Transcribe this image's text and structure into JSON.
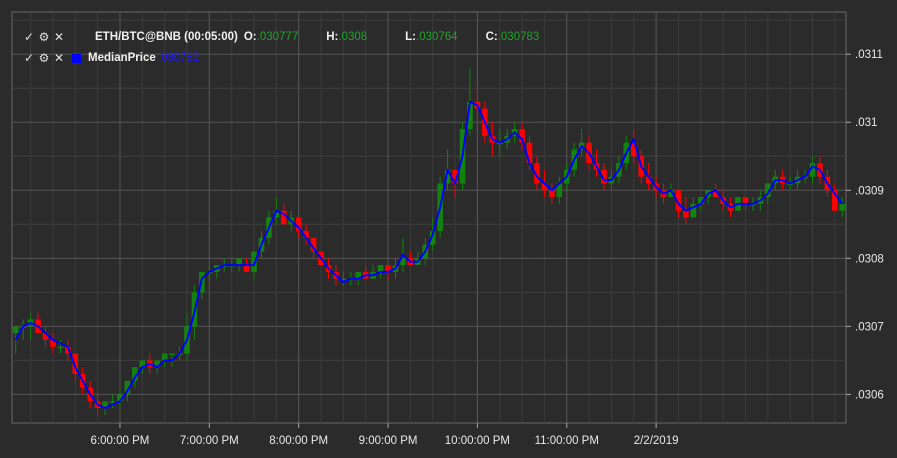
{
  "legend": {
    "series1": {
      "title": "ETH/BTC@BNB (00:05:00)",
      "o_label": "O:",
      "o_value": ".030777",
      "h_label": "H:",
      "h_value": ".0308",
      "l_label": "L:",
      "l_value": ".030764",
      "c_label": "C:",
      "c_value": ".030783"
    },
    "series2": {
      "title": "MedianPrice",
      "value": ".030782"
    }
  },
  "icons": {
    "check": "check-icon",
    "settings": "gear-icon",
    "close": "close-icon"
  },
  "colors": {
    "background": "#2b2b2b",
    "grid_major": "#555555",
    "grid_minor": "#3c3c3c",
    "up": "#14820f",
    "down": "#ff0000",
    "median_line": "#0000ff",
    "text": "#e8e8e8",
    "legend_value": "#1fa32a"
  },
  "chart_data": {
    "type": "candlestick",
    "y_ticks": [
      ".0306",
      ".0307",
      ".0308",
      ".0309",
      ".031",
      ".0311"
    ],
    "y_tick_values": [
      0.0306,
      0.0307,
      0.0308,
      0.0309,
      0.031,
      0.0311
    ],
    "ylim": [
      0.030558,
      0.031162
    ],
    "x_ticks": [
      "6:00:00 PM",
      "7:00:00 PM",
      "8:00:00 PM",
      "9:00:00 PM",
      "10:00:00 PM",
      "11:00:00 PM",
      "2/2/2019"
    ],
    "x_tick_candle_index": [
      14,
      26,
      38,
      50,
      62,
      74,
      86
    ],
    "grid": true,
    "candles": [
      [
        0.03069,
        0.0307,
        0.03066,
        0.0307
      ],
      [
        0.0307,
        0.03071,
        0.03068,
        0.0307
      ],
      [
        0.0307,
        0.03072,
        0.03068,
        0.03071
      ],
      [
        0.03071,
        0.03072,
        0.03069,
        0.03069
      ],
      [
        0.03069,
        0.0307,
        0.03067,
        0.03068
      ],
      [
        0.03068,
        0.03069,
        0.03066,
        0.03067
      ],
      [
        0.03067,
        0.03068,
        0.03066,
        0.03067
      ],
      [
        0.03067,
        0.03068,
        0.03065,
        0.03066
      ],
      [
        0.03066,
        0.03066,
        0.03062,
        0.03063
      ],
      [
        0.03063,
        0.03064,
        0.0306,
        0.03061
      ],
      [
        0.03061,
        0.03062,
        0.03058,
        0.03059
      ],
      [
        0.03059,
        0.0306,
        0.03057,
        0.03058
      ],
      [
        0.03058,
        0.03059,
        0.03057,
        0.03059
      ],
      [
        0.03059,
        0.0306,
        0.03058,
        0.03059
      ],
      [
        0.03059,
        0.03061,
        0.03058,
        0.0306
      ],
      [
        0.0306,
        0.03062,
        0.03059,
        0.03062
      ],
      [
        0.03062,
        0.03064,
        0.03061,
        0.03064
      ],
      [
        0.03064,
        0.03065,
        0.03063,
        0.03065
      ],
      [
        0.03065,
        0.03066,
        0.03063,
        0.03064
      ],
      [
        0.03064,
        0.03065,
        0.03063,
        0.03065
      ],
      [
        0.03065,
        0.03066,
        0.03064,
        0.03066
      ],
      [
        0.03066,
        0.03066,
        0.03064,
        0.03066
      ],
      [
        0.03066,
        0.03067,
        0.03065,
        0.03066
      ],
      [
        0.03066,
        0.03072,
        0.03065,
        0.0307
      ],
      [
        0.0307,
        0.03076,
        0.03068,
        0.03075
      ],
      [
        0.03075,
        0.03078,
        0.03074,
        0.03078
      ],
      [
        0.03078,
        0.03079,
        0.03077,
        0.03078
      ],
      [
        0.03078,
        0.03079,
        0.03077,
        0.03079
      ],
      [
        0.03079,
        0.0308,
        0.03078,
        0.03079
      ],
      [
        0.03079,
        0.0308,
        0.03078,
        0.03079
      ],
      [
        0.03079,
        0.0308,
        0.03078,
        0.0308
      ],
      [
        0.03079,
        0.0308,
        0.03078,
        0.03078
      ],
      [
        0.03078,
        0.03081,
        0.03077,
        0.03081
      ],
      [
        0.03081,
        0.03084,
        0.0308,
        0.03083
      ],
      [
        0.03083,
        0.03087,
        0.03082,
        0.03086
      ],
      [
        0.03086,
        0.03089,
        0.03085,
        0.03087
      ],
      [
        0.03087,
        0.03088,
        0.03085,
        0.03085
      ],
      [
        0.03085,
        0.03087,
        0.03084,
        0.03086
      ],
      [
        0.03086,
        0.03086,
        0.03083,
        0.03084
      ],
      [
        0.03084,
        0.03085,
        0.03082,
        0.03083
      ],
      [
        0.03083,
        0.03083,
        0.0308,
        0.03081
      ],
      [
        0.03081,
        0.03081,
        0.03079,
        0.03079
      ],
      [
        0.03079,
        0.0308,
        0.03077,
        0.03078
      ],
      [
        0.03078,
        0.03079,
        0.03076,
        0.03077
      ],
      [
        0.03077,
        0.03078,
        0.03076,
        0.03077
      ],
      [
        0.03077,
        0.03078,
        0.03076,
        0.03077
      ],
      [
        0.03077,
        0.03078,
        0.03076,
        0.03078
      ],
      [
        0.03078,
        0.03079,
        0.03077,
        0.03077
      ],
      [
        0.03077,
        0.03079,
        0.03077,
        0.03078
      ],
      [
        0.03078,
        0.03079,
        0.03077,
        0.03079
      ],
      [
        0.03079,
        0.03079,
        0.03077,
        0.03078
      ],
      [
        0.03078,
        0.0308,
        0.03077,
        0.03079
      ],
      [
        0.03079,
        0.03083,
        0.03078,
        0.0308
      ],
      [
        0.0308,
        0.03081,
        0.03079,
        0.03079
      ],
      [
        0.03079,
        0.03081,
        0.03079,
        0.0308
      ],
      [
        0.0308,
        0.03083,
        0.03079,
        0.03082
      ],
      [
        0.03082,
        0.03086,
        0.03081,
        0.03084
      ],
      [
        0.03084,
        0.03092,
        0.03083,
        0.03091
      ],
      [
        0.03091,
        0.03096,
        0.0309,
        0.03093
      ],
      [
        0.03093,
        0.03093,
        0.03089,
        0.03091
      ],
      [
        0.03091,
        0.031,
        0.0309,
        0.03099
      ],
      [
        0.03099,
        0.03108,
        0.03098,
        0.03103
      ],
      [
        0.03103,
        0.03105,
        0.031,
        0.03102
      ],
      [
        0.03102,
        0.03103,
        0.03097,
        0.03098
      ],
      [
        0.03098,
        0.031,
        0.03095,
        0.03097
      ],
      [
        0.03097,
        0.03099,
        0.03095,
        0.03097
      ],
      [
        0.03097,
        0.03099,
        0.03096,
        0.03098
      ],
      [
        0.03098,
        0.031,
        0.03097,
        0.03099
      ],
      [
        0.03099,
        0.031,
        0.03096,
        0.03097
      ],
      [
        0.03097,
        0.03098,
        0.03093,
        0.03094
      ],
      [
        0.03094,
        0.03095,
        0.0309,
        0.03091
      ],
      [
        0.03091,
        0.03093,
        0.03089,
        0.0309
      ],
      [
        0.0309,
        0.03091,
        0.03088,
        0.03089
      ],
      [
        0.03089,
        0.03092,
        0.03088,
        0.03091
      ],
      [
        0.03091,
        0.03094,
        0.0309,
        0.03093
      ],
      [
        0.03093,
        0.03097,
        0.03092,
        0.03096
      ],
      [
        0.03096,
        0.03099,
        0.03095,
        0.03097
      ],
      [
        0.03097,
        0.03098,
        0.03093,
        0.03094
      ],
      [
        0.03094,
        0.03096,
        0.03092,
        0.03093
      ],
      [
        0.03093,
        0.03094,
        0.0309,
        0.03091
      ],
      [
        0.03091,
        0.03093,
        0.0309,
        0.03092
      ],
      [
        0.03092,
        0.03095,
        0.03091,
        0.03094
      ],
      [
        0.03094,
        0.03098,
        0.03093,
        0.03097
      ],
      [
        0.03097,
        0.03099,
        0.03094,
        0.03095
      ],
      [
        0.03095,
        0.03096,
        0.03091,
        0.03092
      ],
      [
        0.03092,
        0.03094,
        0.0309,
        0.03091
      ],
      [
        0.03091,
        0.03092,
        0.03089,
        0.0309
      ],
      [
        0.0309,
        0.03091,
        0.03088,
        0.03089
      ],
      [
        0.03089,
        0.03091,
        0.03089,
        0.0309
      ],
      [
        0.0309,
        0.0309,
        0.03086,
        0.03087
      ],
      [
        0.03087,
        0.03089,
        0.03085,
        0.03086
      ],
      [
        0.03086,
        0.03089,
        0.03086,
        0.03088
      ],
      [
        0.03088,
        0.03089,
        0.03087,
        0.03089
      ],
      [
        0.03089,
        0.0309,
        0.03088,
        0.0309
      ],
      [
        0.0309,
        0.03091,
        0.03089,
        0.03089
      ],
      [
        0.03089,
        0.0309,
        0.03087,
        0.03088
      ],
      [
        0.03088,
        0.03089,
        0.03086,
        0.03087
      ],
      [
        0.03087,
        0.03089,
        0.03087,
        0.03089
      ],
      [
        0.03089,
        0.03089,
        0.03087,
        0.03088
      ],
      [
        0.03088,
        0.03089,
        0.03087,
        0.03088
      ],
      [
        0.03088,
        0.0309,
        0.03087,
        0.03089
      ],
      [
        0.03089,
        0.03091,
        0.03088,
        0.03091
      ],
      [
        0.03091,
        0.03093,
        0.0309,
        0.03092
      ],
      [
        0.03092,
        0.03093,
        0.0309,
        0.03091
      ],
      [
        0.03091,
        0.03092,
        0.0309,
        0.03091
      ],
      [
        0.03091,
        0.03093,
        0.0309,
        0.03092
      ],
      [
        0.03092,
        0.03093,
        0.03091,
        0.03092
      ],
      [
        0.03092,
        0.03095,
        0.03091,
        0.03094
      ],
      [
        0.03094,
        0.03095,
        0.03091,
        0.03092
      ],
      [
        0.03092,
        0.03093,
        0.03089,
        0.0309
      ],
      [
        0.0309,
        0.03091,
        0.03087,
        0.03087
      ],
      [
        0.03087,
        0.03089,
        0.03086,
        0.03088
      ]
    ],
    "median_price": [
      0.03068,
      0.0307,
      0.030705,
      0.0307,
      0.03069,
      0.03068,
      0.030675,
      0.03067,
      0.03064,
      0.03062,
      0.0306,
      0.030585,
      0.03058,
      0.030585,
      0.03059,
      0.030605,
      0.030625,
      0.03064,
      0.030645,
      0.03064,
      0.03065,
      0.03065,
      0.03066,
      0.03068,
      0.03072,
      0.03077,
      0.03078,
      0.030785,
      0.03079,
      0.03079,
      0.03079,
      0.03079,
      0.03079,
      0.03082,
      0.030845,
      0.03087,
      0.030865,
      0.030855,
      0.030845,
      0.03083,
      0.030815,
      0.0308,
      0.030785,
      0.030775,
      0.030765,
      0.03077,
      0.03077,
      0.030775,
      0.030775,
      0.03078,
      0.03078,
      0.030785,
      0.030805,
      0.030795,
      0.030795,
      0.03081,
      0.030835,
      0.030875,
      0.03093,
      0.03091,
      0.03095,
      0.03103,
      0.031025,
      0.031,
      0.030975,
      0.03097,
      0.030975,
      0.030985,
      0.030975,
      0.03094,
      0.03092,
      0.03091,
      0.0309,
      0.03091,
      0.03092,
      0.030945,
      0.030965,
      0.030955,
      0.030935,
      0.030915,
      0.030915,
      0.03093,
      0.030955,
      0.030975,
      0.030935,
      0.03092,
      0.030905,
      0.030895,
      0.0309,
      0.03088,
      0.03087,
      0.030875,
      0.03088,
      0.030895,
      0.0309,
      0.030885,
      0.030875,
      0.03088,
      0.03088,
      0.03088,
      0.030885,
      0.030895,
      0.030915,
      0.030915,
      0.03091,
      0.030915,
      0.03092,
      0.030935,
      0.03093,
      0.03091,
      0.030895,
      0.03088
    ]
  }
}
